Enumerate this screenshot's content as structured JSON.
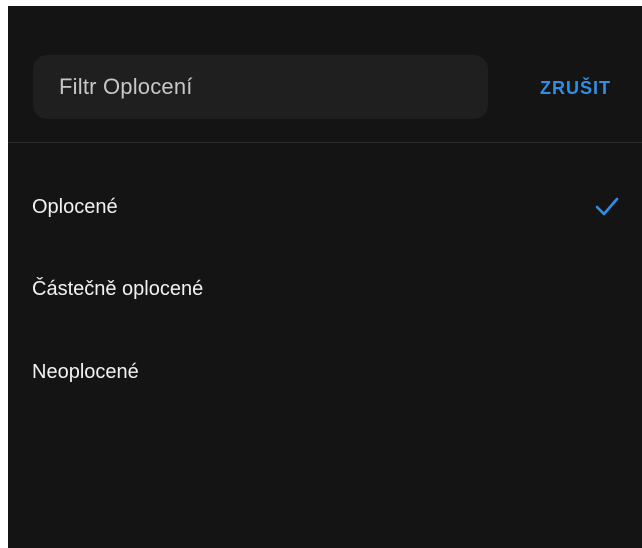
{
  "header": {
    "search_label": "Filtr Oplocení",
    "cancel_label": "ZRUŠIT"
  },
  "options": [
    {
      "label": "Oplocené",
      "selected": true
    },
    {
      "label": "Částečně oplocené",
      "selected": false
    },
    {
      "label": "Neoplocené",
      "selected": false
    }
  ],
  "icons": {
    "selected_indicator": "check-icon"
  },
  "colors": {
    "background": "#141414",
    "search_box": "#1f1f1f",
    "accent": "#2f8fe6",
    "text": "#f2f2f2"
  }
}
